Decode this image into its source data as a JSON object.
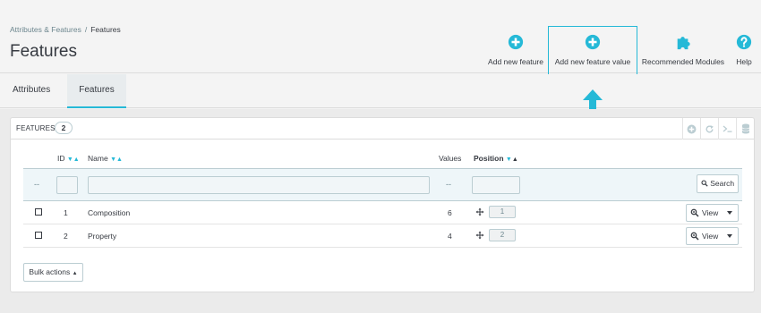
{
  "breadcrumb": {
    "parent": "Attributes & Features",
    "separator": "/",
    "current": "Features"
  },
  "page_title": "Features",
  "toolbar": {
    "add_feature": "Add new feature",
    "add_feature_value": "Add new feature value",
    "recommended_modules": "Recommended Modules",
    "help": "Help"
  },
  "tabs": [
    {
      "label": "Attributes"
    },
    {
      "label": "Features"
    }
  ],
  "panel": {
    "title": "Features",
    "count": "2"
  },
  "columns": {
    "id": "ID",
    "name": "Name",
    "values": "Values",
    "position": "Position"
  },
  "filters": {
    "dash1": "--",
    "dash2": "--",
    "search_label": "Search"
  },
  "rows": [
    {
      "id": "1",
      "name": "Composition",
      "values": "6",
      "position": "1",
      "action": "View"
    },
    {
      "id": "2",
      "name": "Property",
      "values": "4",
      "position": "2",
      "action": "View"
    }
  ],
  "bulk_actions": "Bulk actions",
  "colors": {
    "accent": "#25b9d7",
    "text": "#363a41",
    "border": "#bbcdd2"
  },
  "icons": {
    "add_feature": "plus-circle-icon",
    "add_feature_value": "plus-circle-icon",
    "recommended_modules": "puzzle-icon",
    "help": "question-circle-icon"
  }
}
